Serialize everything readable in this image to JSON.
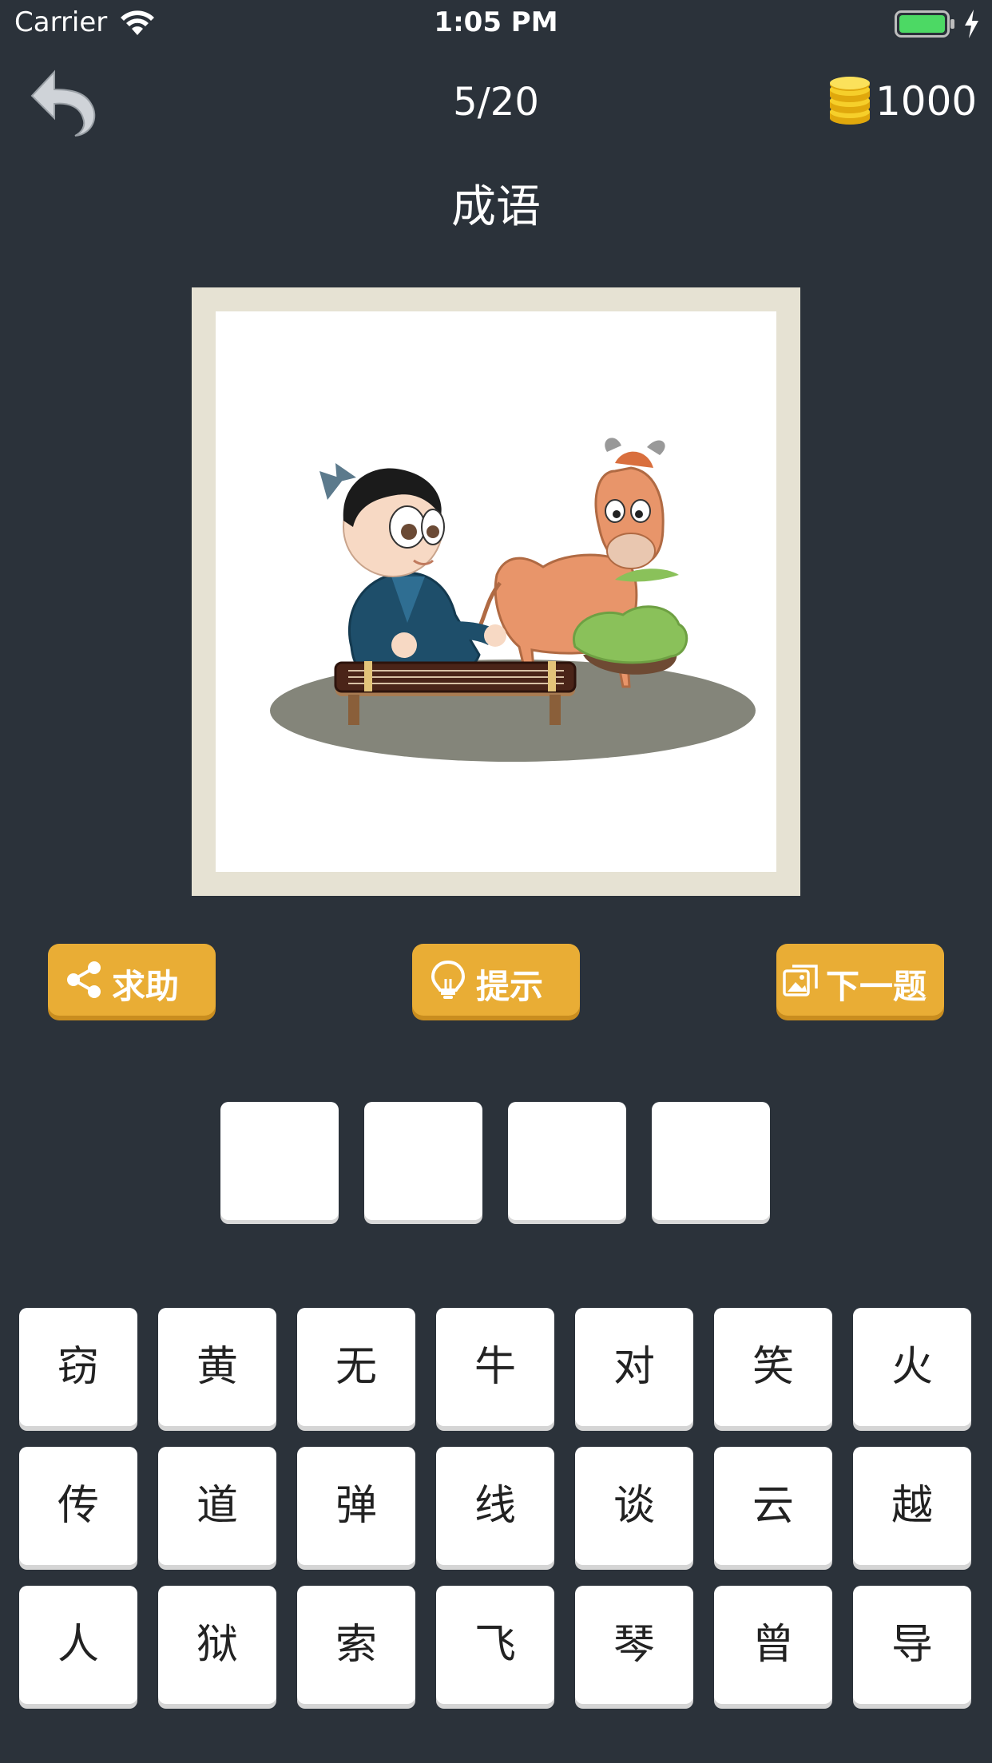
{
  "status_bar": {
    "carrier": "Carrier",
    "time": "1:05 PM",
    "battery_color": "#4cd964"
  },
  "header": {
    "progress": "5/20",
    "coins": "1000",
    "category": "成语"
  },
  "picture": {
    "icon": "illustration-man-playing-zither-to-cow"
  },
  "actions": {
    "help_label": "求助",
    "hint_label": "提示",
    "next_label": "下一题",
    "button_color": "#e9ad35"
  },
  "answer": {
    "slots": [
      "",
      "",
      "",
      ""
    ]
  },
  "keyboard": {
    "rows": [
      [
        "窃",
        "黄",
        "无",
        "牛",
        "对",
        "笑",
        "火"
      ],
      [
        "传",
        "道",
        "弹",
        "线",
        "谈",
        "云",
        "越"
      ],
      [
        "人",
        "狱",
        "索",
        "飞",
        "琴",
        "曾",
        "导"
      ]
    ]
  },
  "colors": {
    "background": "#2b323a"
  }
}
